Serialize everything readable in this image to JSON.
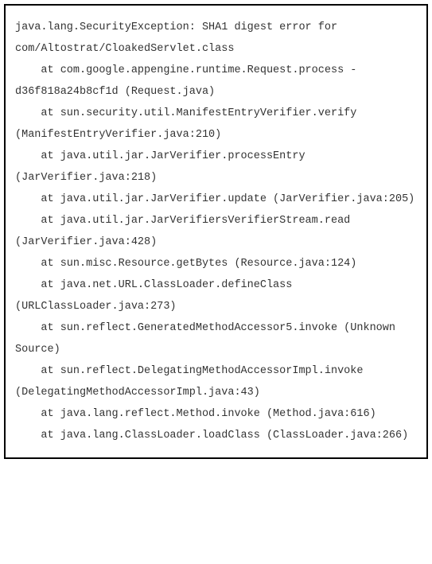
{
  "stacktrace": {
    "header": "java.lang.SecurityException: SHA1 digest error for com/Altostrat/CloakedServlet.class",
    "frames": [
      "    at com.google.appengine.runtime.Request.process -d36f818a24b8cf1d (Request.java)",
      "    at sun.security.util.ManifestEntryVerifier.verify (ManifestEntryVerifier.java:210)",
      "    at java.util.jar.JarVerifier.processEntry (JarVerifier.java:218)",
      "    at java.util.jar.JarVerifier.update (JarVerifier.java:205)",
      "    at java.util.jar.JarVerifiersVerifierStream.read (JarVerifier.java:428)",
      "    at sun.misc.Resource.getBytes (Resource.java:124)",
      "    at java.net.URL.ClassLoader.defineClass (URLClassLoader.java:273)",
      "    at sun.reflect.GeneratedMethodAccessor5.invoke (Unknown Source)",
      "    at sun.reflect.DelegatingMethodAccessorImpl.invoke (DelegatingMethodAccessorImpl.java:43)",
      "    at java.lang.reflect.Method.invoke (Method.java:616)",
      "    at java.lang.ClassLoader.loadClass (ClassLoader.java:266)"
    ]
  }
}
